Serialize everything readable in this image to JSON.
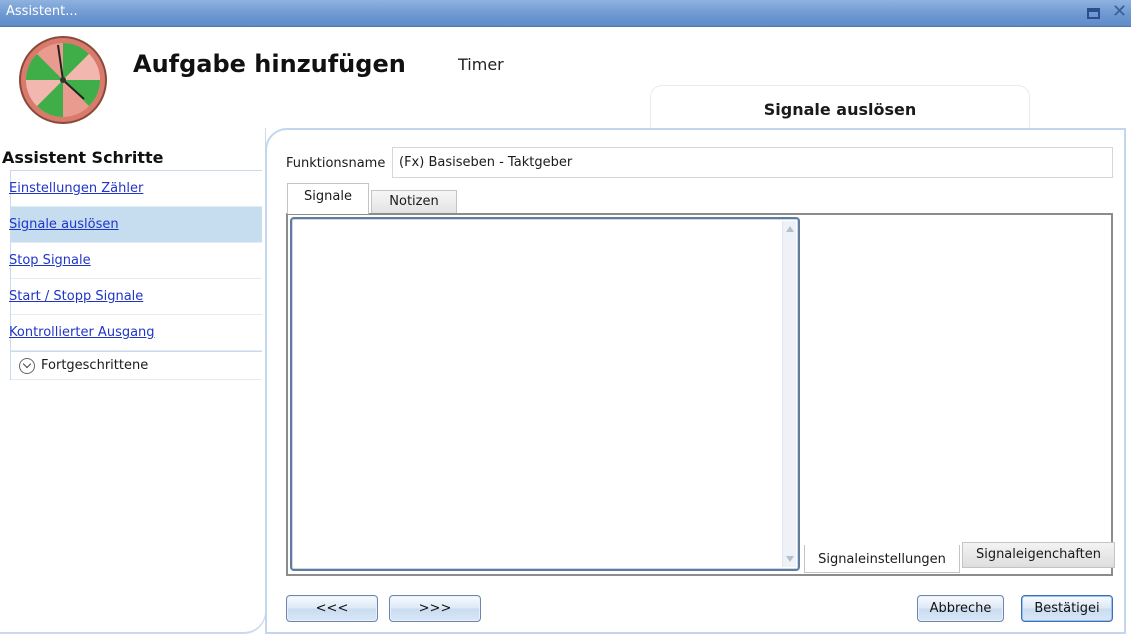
{
  "window": {
    "title": "Assistent..."
  },
  "header": {
    "title": "Aufgabe hinzufügen",
    "subtitle": "Timer",
    "current_step": "Signale auslösen"
  },
  "sidebar": {
    "title": "Assistent Schritte",
    "items": [
      {
        "label": "Einstellungen Zähler",
        "active": false
      },
      {
        "label": "Signale auslösen",
        "active": true
      },
      {
        "label": "Stop Signale",
        "active": false
      },
      {
        "label": "Start / Stopp Signale",
        "active": false
      },
      {
        "label": "Kontrollierter Ausgang",
        "active": false
      }
    ],
    "advanced_label": "Fortgeschrittene"
  },
  "main": {
    "function_name_label": "Funktionsname",
    "function_name_value": "(Fx) Basiseben - Taktgeber",
    "tabs": [
      "Signale",
      "Notizen"
    ],
    "inner_tabs": [
      "Signaleinstellungen",
      "Signaleigenchaften"
    ]
  },
  "footer": {
    "prev_label": "<<<",
    "next_label": ">>>",
    "cancel_label": "Abbreche",
    "confirm_label": "Bestätigei"
  },
  "icons": {
    "logo": "timer-wheel-icon",
    "maximize": "maximize-icon",
    "close": "close-icon",
    "advanced": "chevron-down-icon"
  },
  "colors": {
    "titlebar": "#6e98d1",
    "active_item": "#c6dcef",
    "link": "#1f35c8",
    "panel_border": "#c3d6ee"
  }
}
